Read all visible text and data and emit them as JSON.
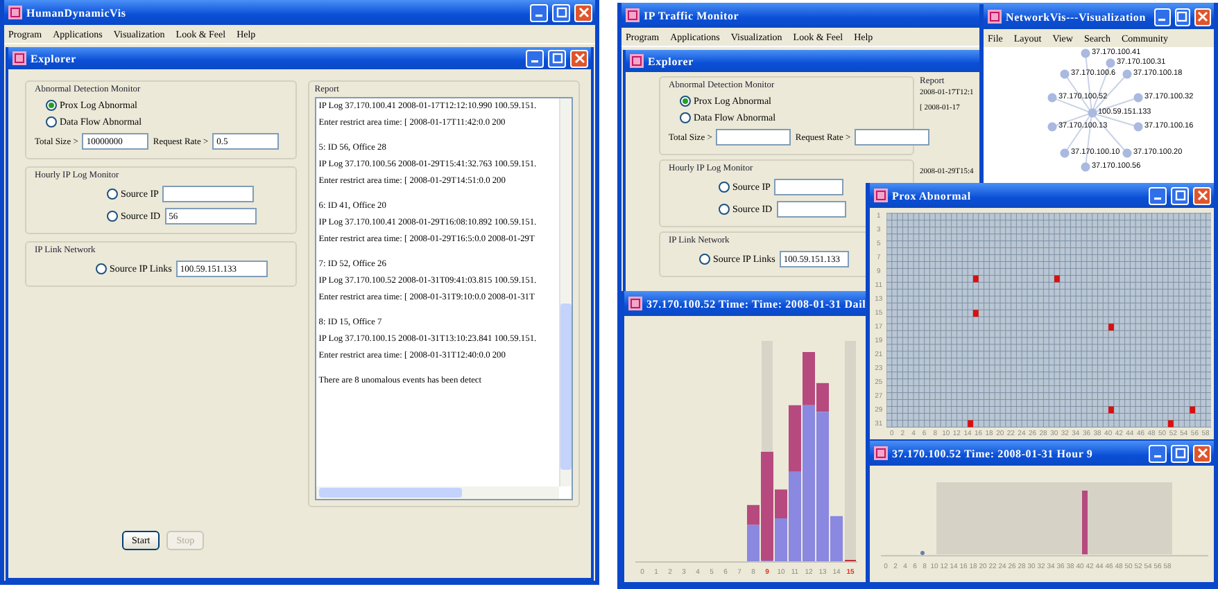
{
  "left_window": {
    "title": "HumanDynamicVis",
    "menu": [
      "Program",
      "Applications",
      "Visualization",
      "Look & Feel",
      "Help"
    ],
    "explorer": {
      "title": "Explorer",
      "abnormal_group": {
        "title": "Abnormal Detection Monitor",
        "options": [
          {
            "label": "Prox Log Abnormal",
            "selected": true
          },
          {
            "label": "Data Flow Abnormal",
            "selected": false
          }
        ],
        "total_size_label": "Total Size >",
        "total_size": "10000000",
        "request_rate_label": "Request Rate >",
        "request_rate": "0.5"
      },
      "hourly_group": {
        "title": "Hourly IP Log Monitor",
        "options": [
          {
            "label": "Source IP",
            "selected": false
          },
          {
            "label": "Source ID",
            "selected": false,
            "value": "56"
          }
        ]
      },
      "link_group": {
        "title": "IP Link Network",
        "options": [
          {
            "label": "Source IP Links",
            "selected": false,
            "value": "100.59.151.133"
          }
        ]
      },
      "report": {
        "title": "Report",
        "entries": [
          [
            "IP Log 37.170.100.41 2008-01-17T12:12:10.990 100.59.151.",
            "Enter restrict area time: [ 2008-01-17T11:42:0.0 200"
          ],
          [
            "5: ID 56, Office 28",
            "IP Log 37.170.100.56 2008-01-29T15:41:32.763 100.59.151.",
            "Enter restrict area time: [ 2008-01-29T14:51:0.0 200"
          ],
          [
            "6: ID 41, Office 20",
            "IP Log 37.170.100.41 2008-01-29T16:08:10.892 100.59.151.",
            "Enter restrict area time: [ 2008-01-29T16:5:0.0 2008-01-29T"
          ],
          [
            "7: ID 52, Office 26",
            "IP Log 37.170.100.52 2008-01-31T09:41:03.815 100.59.151.",
            "Enter restrict area time: [ 2008-01-31T9:10:0.0 2008-01-31T"
          ],
          [
            "8: ID 15, Office 7",
            "IP Log 37.170.100.15 2008-01-31T13:10:23.841 100.59.151.",
            "Enter restrict area time: [ 2008-01-31T12:40:0.0 200"
          ],
          [
            "There are 8 unomalous events has been detect"
          ]
        ]
      },
      "buttons": [
        {
          "label": "Start",
          "disabled": false
        },
        {
          "label": "Stop",
          "disabled": true
        }
      ]
    }
  },
  "right_window": {
    "title": "IP Traffic Monitor",
    "menu": [
      "Program",
      "Applications",
      "Visualization",
      "Look & Feel",
      "Help"
    ],
    "explorer": {
      "title": "Explorer",
      "abnormal_group": {
        "title": "Abnormal Detection Monitor",
        "options": [
          {
            "label": "Prox Log Abnormal",
            "selected": true
          },
          {
            "label": "Data Flow Abnormal",
            "selected": false
          }
        ],
        "total_size_label": "Total Size >",
        "request_rate_label": "Request Rate >"
      },
      "hourly_group": {
        "title": "Hourly IP Log Monitor",
        "options": [
          {
            "label": "Source IP",
            "selected": false
          },
          {
            "label": "Source ID",
            "selected": false
          }
        ]
      },
      "link_group": {
        "title": "IP Link Network",
        "options": [
          {
            "label": "Source IP Links",
            "selected": false,
            "value": "100.59.151.133"
          }
        ]
      },
      "report": {
        "title": "Report",
        "entries": [
          [
            "2008-01-17T12:1",
            "[ 2008-01-17"
          ],
          [
            "2008-01-29T15:4"
          ]
        ]
      }
    }
  },
  "network_window": {
    "title": "NetworkVis---Visualization",
    "menu": [
      "File",
      "Layout",
      "View",
      "Search",
      "Community"
    ],
    "center": "100.59.151.133",
    "nodes": [
      "37.170.100.41",
      "37.170.100.31",
      "37.170.100.6",
      "37.170.100.18",
      "37.170.100.52",
      "37.170.100.32",
      "37.170.100.13",
      "37.170.100.16",
      "37.170.100.10",
      "37.170.100.20",
      "37.170.100.56"
    ]
  },
  "prox_window": {
    "title": "Prox Abnormal",
    "y_labels": [
      "1",
      "3",
      "5",
      "7",
      "9",
      "11",
      "13",
      "15",
      "17",
      "19",
      "21",
      "23",
      "25",
      "27",
      "29",
      "31"
    ],
    "x_labels": [
      "0",
      "2",
      "4",
      "6",
      "8",
      "10",
      "12",
      "14",
      "16",
      "18",
      "20",
      "22",
      "24",
      "26",
      "28",
      "30",
      "32",
      "34",
      "36",
      "38",
      "40",
      "42",
      "44",
      "46",
      "48",
      "50",
      "52",
      "54",
      "56",
      "58"
    ]
  },
  "daily_window": {
    "title": "37.170.100.52 Time:  Time: 2008-01-31 Dail",
    "x_labels": [
      {
        "text": "0",
        "highlighted": false
      },
      {
        "text": "1",
        "highlighted": false
      },
      {
        "text": "2",
        "highlighted": false
      },
      {
        "text": "3",
        "highlighted": false
      },
      {
        "text": "4",
        "highlighted": false
      },
      {
        "text": "5",
        "highlighted": false
      },
      {
        "text": "6",
        "highlighted": false
      },
      {
        "text": "7",
        "highlighted": false
      },
      {
        "text": "8",
        "highlighted": false
      },
      {
        "text": "9",
        "highlighted": true
      },
      {
        "text": "10",
        "highlighted": false
      },
      {
        "text": "11",
        "highlighted": false
      },
      {
        "text": "12",
        "highlighted": false
      },
      {
        "text": "13",
        "highlighted": false
      },
      {
        "text": "14",
        "highlighted": false
      },
      {
        "text": "15",
        "highlighted": true
      }
    ]
  },
  "hour_window": {
    "title": "37.170.100.52 Time: 2008-01-31 Hour 9",
    "x_labels": [
      "0",
      "2",
      "4",
      "6",
      "8",
      "10",
      "12",
      "14",
      "16",
      "18",
      "20",
      "22",
      "24",
      "26",
      "28",
      "30",
      "32",
      "34",
      "36",
      "38",
      "40",
      "42",
      "44",
      "46",
      "48",
      "50",
      "52",
      "54",
      "56",
      "58"
    ]
  }
}
